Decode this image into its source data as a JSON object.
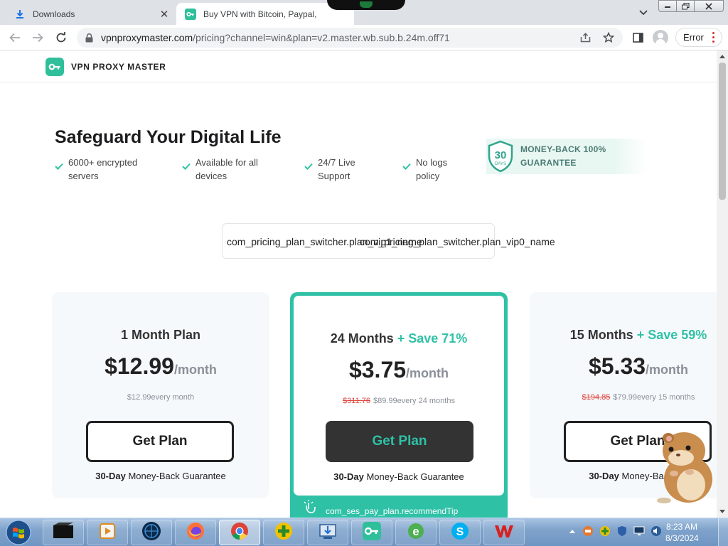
{
  "browser": {
    "tabs": [
      {
        "title": "Downloads",
        "active": false,
        "icon": "download-icon"
      },
      {
        "title": "Buy VPN with Bitcoin, Paypal,",
        "active": true,
        "icon": "vpn-favicon"
      }
    ],
    "url_domain": "vpnproxymaster.com",
    "url_path": "/pricing?channel=win&plan=v2.master.wb.sub.b.24m.off71",
    "error_label": "Error"
  },
  "site": {
    "brand": "VPN PROXY MASTER",
    "brand_color": "#2fbf9b"
  },
  "hero": {
    "title": "Safeguard Your Digital Life",
    "features": [
      {
        "line1": "6000+ encrypted",
        "line2": "servers"
      },
      {
        "line1": "Available for all",
        "line2": "devices"
      },
      {
        "line1": "24/7 Live",
        "line2": "Support"
      },
      {
        "line1": "No logs",
        "line2": "policy"
      }
    ],
    "guarantee": {
      "badge_number": "30",
      "badge_sub": "DAYS",
      "line1": "MONEY-BACK 100%",
      "line2": "GUARANTEE"
    }
  },
  "switcher": {
    "option_a": "com_pricing_plan_switcher.plan_vip1_name",
    "option_b": "com_pricing_plan_switcher.plan_vip0_name"
  },
  "plans": [
    {
      "name": "1 Month Plan",
      "save": "",
      "price": "$12.99",
      "per": "/month",
      "original": "",
      "billing": "$12.99every month",
      "cta": "Get Plan",
      "mbg_bold": "30-Day",
      "mbg_rest": " Money-Back Guarantee",
      "featured": false
    },
    {
      "name": "24 Months",
      "save": " + Save 71%",
      "price": "$3.75",
      "per": "/month",
      "original": "$311.76",
      "billing": "$89.99every 24 months",
      "cta": "Get Plan",
      "mbg_bold": "30-Day",
      "mbg_rest": " Money-Back Guarantee",
      "featured": true,
      "tip": "com_ses_pay_plan.recommendTip"
    },
    {
      "name": "15 Months",
      "save": " + Save 59%",
      "price": "$5.33",
      "per": "/month",
      "original": "$194.85",
      "billing": "$79.99every 15 months",
      "cta": "Get Plan",
      "mbg_bold": "30-Day",
      "mbg_rest": " Money-Back Gu",
      "featured": false
    }
  ],
  "taskbar": {
    "apps": [
      "media-player-icon",
      "video-app-icon",
      "globe-app-icon",
      "firefox-icon",
      "chrome-icon",
      "plus-app-icon",
      "download-manager-icon",
      "vpn-app-icon",
      "ie-icon",
      "skype-icon",
      "wps-icon"
    ],
    "clock_time": "8:23 AM",
    "clock_date": "8/3/2024"
  },
  "colors": {
    "accent": "#2fc1a6",
    "strike": "#e0443e",
    "dark_button": "#333333"
  }
}
